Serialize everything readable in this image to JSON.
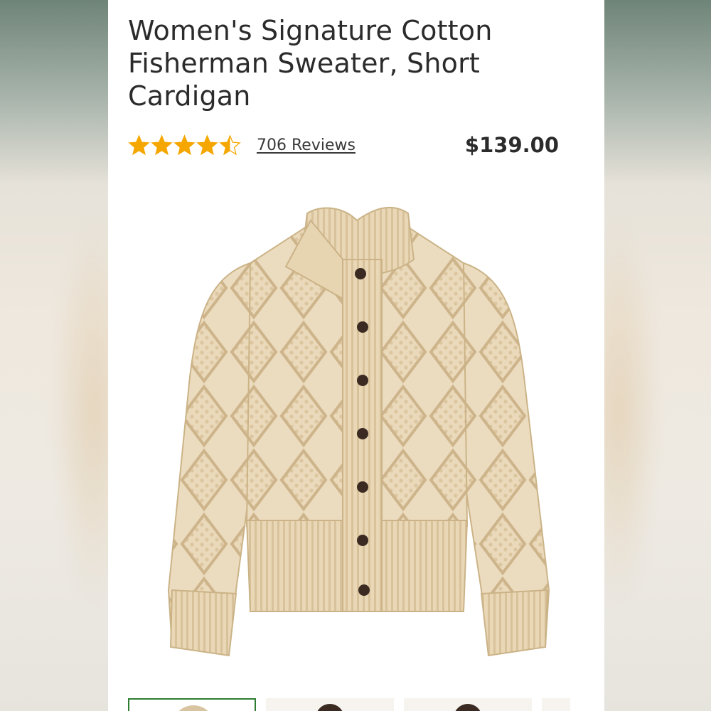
{
  "product": {
    "title": "Women's Signature Cotton Fisherman Sweater, Short Cardigan",
    "rating_value": 4.5,
    "rating_max": 5,
    "reviews_label": "706 Reviews",
    "price": "$139.00"
  },
  "image": {
    "subject": "cable-knit-cardigan-image",
    "buttons_visible": 7
  },
  "thumbnails": {
    "count_visible": 4,
    "active_index": 0
  },
  "colors": {
    "star": "#f5a700",
    "text": "#2b2b2b",
    "sweater": "#ecdcbf",
    "sweater_shadow": "#d6c09a",
    "button": "#3b2a22",
    "thumb_active_border": "#2e7d32"
  }
}
